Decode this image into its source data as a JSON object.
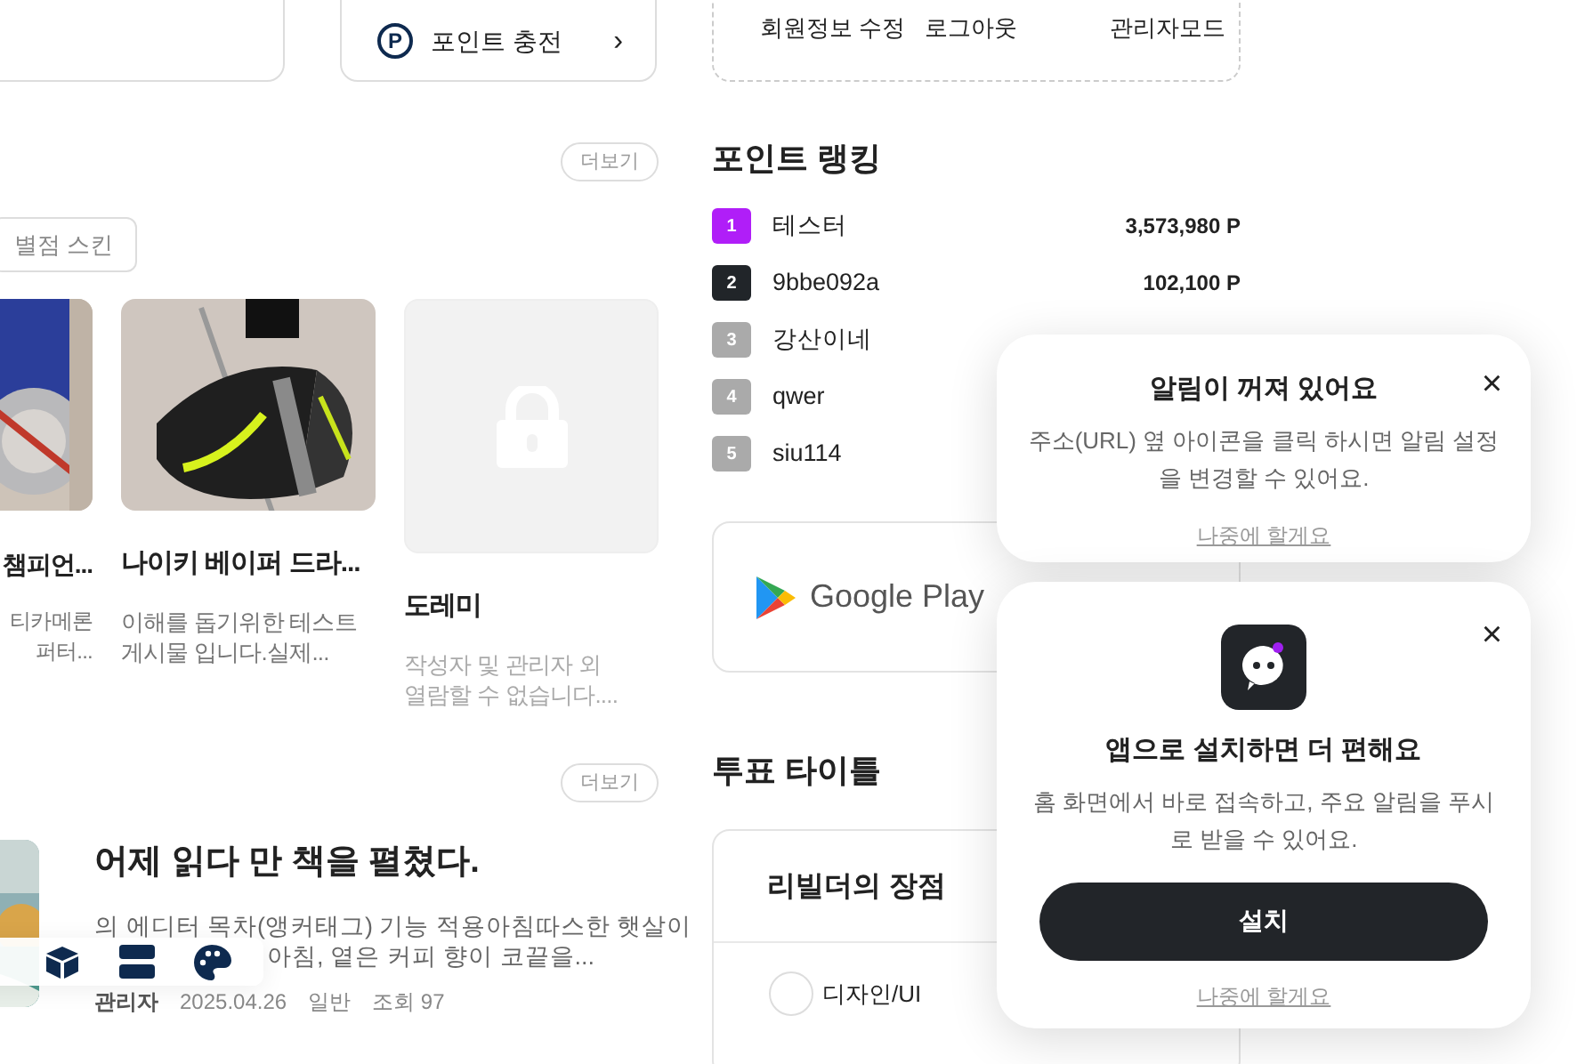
{
  "top_panel": {
    "charge_icon": "P",
    "charge_button": "포인트 충전",
    "charge_arrow": "›"
  },
  "account_links": [
    "회원정보 수정",
    "로그아웃",
    "관리자모드"
  ],
  "gallery": {
    "more": "더보기",
    "tabs": [
      {
        "label": "별점 스킨",
        "selected": false
      }
    ],
    "cards": [
      {
        "title": "챔피언...",
        "excerpt_lines": [
          "티카메론",
          "퍼터..."
        ]
      },
      {
        "title": "나이키 베이퍼 드라...",
        "excerpt_lines": [
          "이해를 돕기위한 테스트",
          "게시물 입니다.실제..."
        ]
      },
      {
        "kind": "locked",
        "title": "도레미",
        "excerpt_lines": [
          "작성자 및 관리자 외",
          "열람할 수 없습니다...."
        ]
      }
    ]
  },
  "posts": {
    "more": "더보기",
    "items": [
      {
        "title": "어제 읽다 만 책을 펼쳤다.",
        "excerpt_lines": [
          "의 에디터 목차(앵커태그) 기능 적용아침따스한 햇살이",
          "아침, 옅은 커피 향이 코끝을..."
        ],
        "author": "관리자",
        "date": "2025.04.26",
        "category": "일반",
        "views": "조회 97"
      }
    ]
  },
  "ranking": {
    "title": "포인트 랭킹",
    "entries": [
      {
        "rank": "1",
        "name": "테스터",
        "points": "3,573,980 P",
        "color": "#b01ef8"
      },
      {
        "rank": "2",
        "name": "9bbe092a",
        "points": "102,100 P",
        "color": "#212529"
      },
      {
        "rank": "3",
        "name": "강산이네",
        "color": "#aaaaaa"
      },
      {
        "rank": "4",
        "name": "qwer",
        "color": "#aaaaaa"
      },
      {
        "rank": "5",
        "name": "siu114",
        "color": "#aaaaaa"
      }
    ]
  },
  "app_card": {
    "store": "Google Play"
  },
  "poll": {
    "title": "투표 타이틀",
    "card_title": "리빌더의 장점",
    "options": [
      {
        "label": "디자인/UI",
        "selected": false
      }
    ]
  },
  "notice_popup": {
    "title": "알림이 꺼져 있어요",
    "close": "×",
    "message_lines": [
      "주소(URL) 옆 아이콘을 클릭 하시면 알림 설정",
      "을 변경할 수 있어요."
    ],
    "later": "나중에 할게요"
  },
  "install_popup": {
    "title": "앱으로 설치하면 더 편해요",
    "close": "×",
    "message_lines": [
      "홈 화면에서 바로 접속하고, 주요 알림을 푸시",
      "로 받을 수 있어요."
    ],
    "button": "설치",
    "later": "나중에 할게요"
  }
}
